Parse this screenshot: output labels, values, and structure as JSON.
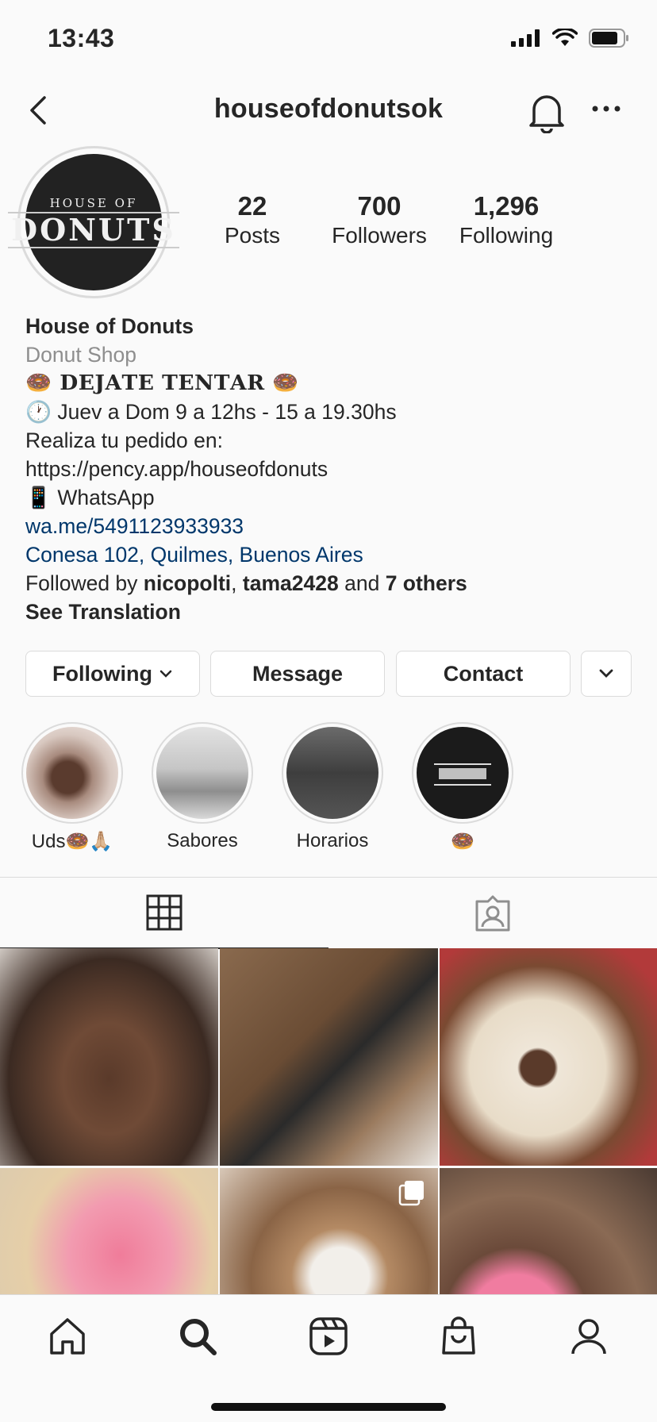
{
  "status_bar": {
    "time": "13:43"
  },
  "header": {
    "username": "houseofdonutsok"
  },
  "profile": {
    "avatar_text_top": "HOUSE OF",
    "avatar_text_main": "DONUTS",
    "stats": [
      {
        "value": "22",
        "label": "Posts"
      },
      {
        "value": "700",
        "label": "Followers"
      },
      {
        "value": "1,296",
        "label": "Following"
      }
    ]
  },
  "bio": {
    "name": "House of Donuts",
    "category": "Donut Shop",
    "tagline": "🍩 𝐃𝐄𝐉𝐀𝐓𝐄 𝐓𝐄𝐍𝐓𝐀𝐑 🍩",
    "hours": "🕐 Juev a Dom 9 a 12hs - 15 a 19.30hs",
    "order_line": "Realiza tu pedido en:",
    "order_url": "https://pency.app/houseofdonuts",
    "whatsapp": "📱 WhatsApp",
    "whatsapp_link": "wa.me/5491123933933",
    "address": "Conesa 102, Quilmes, Buenos Aires",
    "followed_by_prefix": "Followed by ",
    "followed_user_1": "nicopolti",
    "followed_sep": ", ",
    "followed_user_2": "tama2428",
    "followed_and": " and ",
    "followed_others": "7 others",
    "see_translation": "See Translation"
  },
  "actions": {
    "following": "Following",
    "message": "Message",
    "contact": "Contact"
  },
  "highlights": [
    {
      "label": "Uds🍩🙏🏼"
    },
    {
      "label": "Sabores"
    },
    {
      "label": "Horarios"
    },
    {
      "label": "🍩"
    }
  ],
  "colors": {
    "link": "#00376b",
    "secondary_text": "#8e8e8e",
    "border": "#dbdbdb"
  },
  "icons": [
    "back-icon",
    "bell-icon",
    "more-icon",
    "grid-icon",
    "tagged-icon",
    "home-icon",
    "search-icon",
    "reels-icon",
    "shop-icon",
    "profile-icon",
    "chevron-down-icon",
    "multi-post-icon"
  ]
}
